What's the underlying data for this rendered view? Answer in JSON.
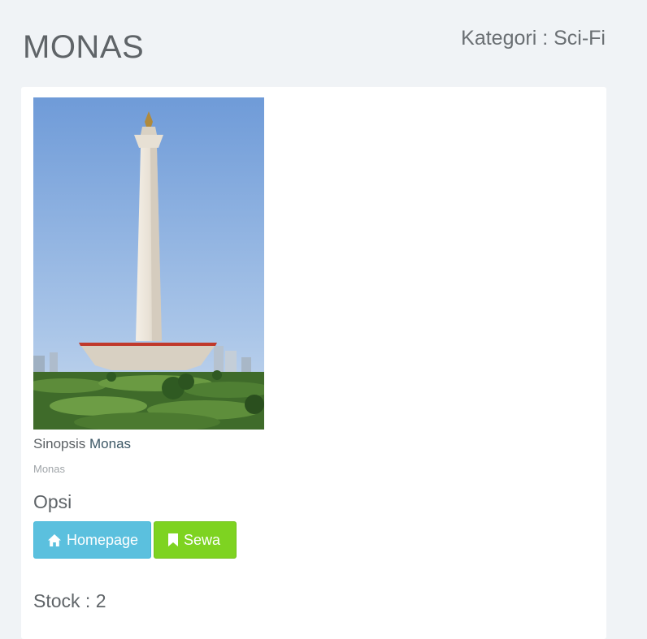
{
  "page": {
    "title": "MONAS",
    "category": "Kategori : Sci-Fi"
  },
  "poster": {
    "alt": "Monas"
  },
  "synopsis": {
    "label": "Sinopsis",
    "name": "Monas",
    "text": "Monas"
  },
  "options": {
    "heading": "Opsi",
    "homepage_label": "Homepage",
    "rent_label": "Sewa"
  },
  "stock": {
    "text": "Stock : 2"
  },
  "colors": {
    "homepage_button": "#5bc0de",
    "rent_button": "#7ed321",
    "background": "#f0f3f6"
  },
  "icons": {
    "homepage": "home-icon",
    "rent": "bookmark-icon"
  }
}
